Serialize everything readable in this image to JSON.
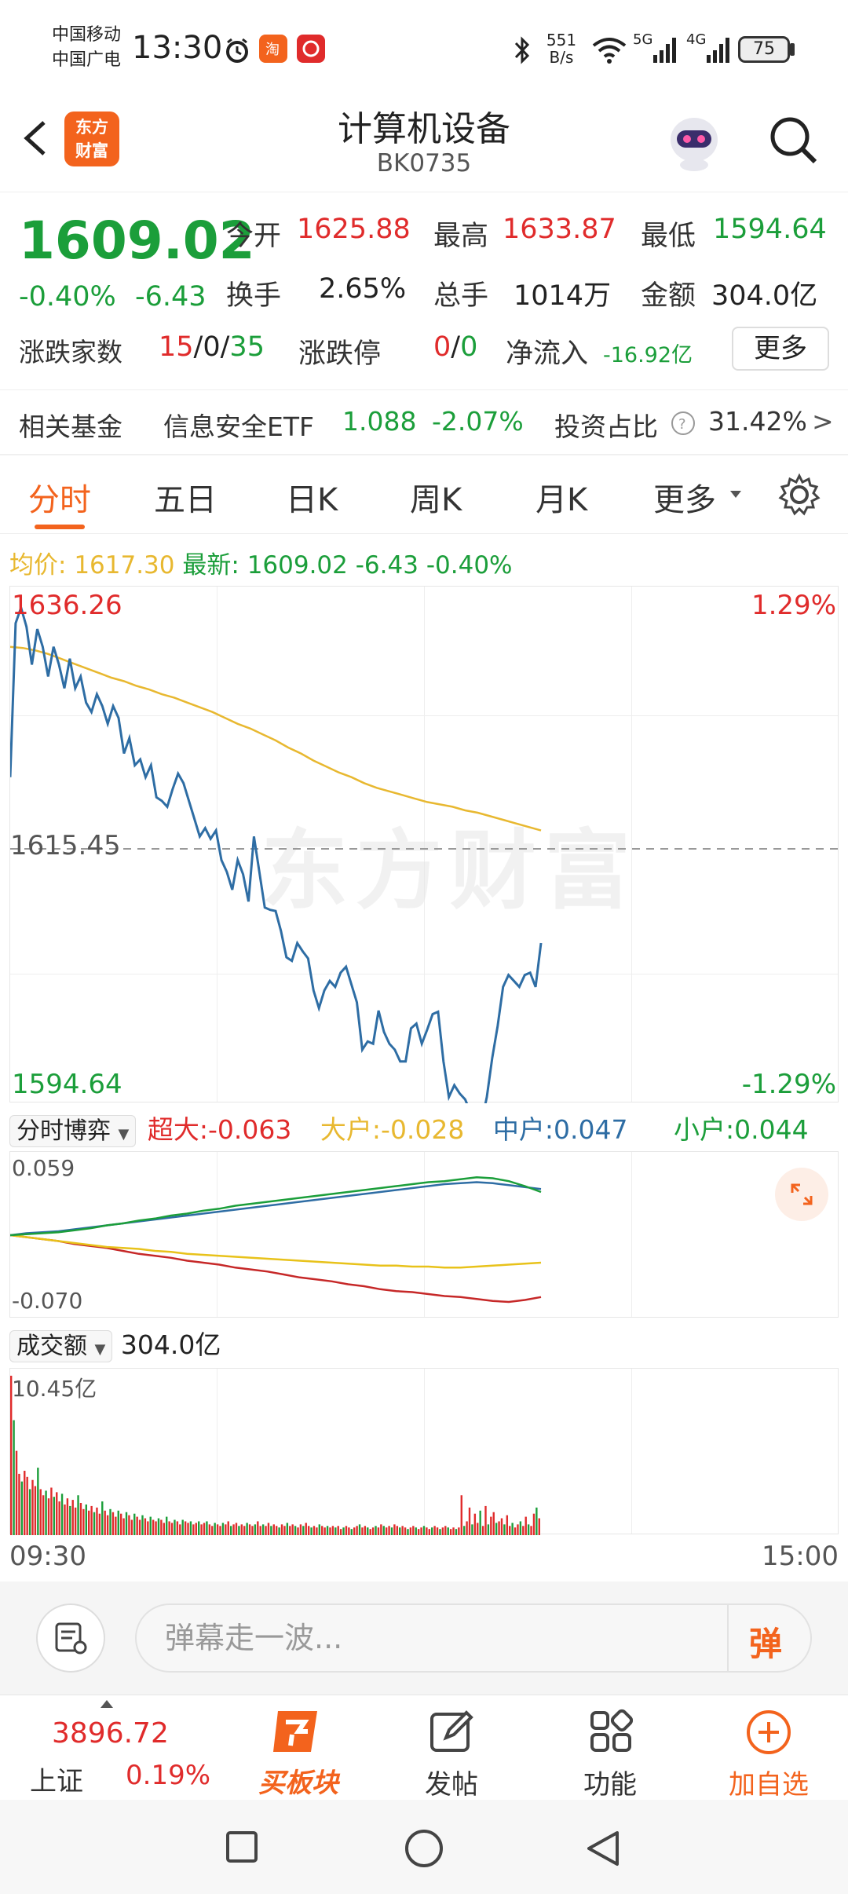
{
  "status_bar": {
    "carrier1": "中国移动",
    "carrier2": "中国广电",
    "time": "13:30",
    "net_speed_value": "551",
    "net_speed_unit": "B/s",
    "sig1": "5G",
    "sig2": "4G",
    "battery": "75",
    "icons": [
      "alarm-icon",
      "taobao-icon",
      "app-icon",
      "bluetooth-icon",
      "wifi-icon",
      "signal-icon"
    ]
  },
  "header": {
    "logo_line1": "东方",
    "logo_line2": "财富",
    "title": "计算机设备",
    "code": "BK0735"
  },
  "quote": {
    "price": "1609.02",
    "change_pct": "-0.40%",
    "change": "-6.43",
    "open_label": "今开",
    "open": "1625.88",
    "high_label": "最高",
    "high": "1633.87",
    "low_label": "最低",
    "low": "1594.64",
    "turnover_label": "换手",
    "turnover": "2.65%",
    "volume_label": "总手",
    "volume": "1014万",
    "amount_label": "金额",
    "amount": "304.0亿",
    "updown_label": "涨跌家数",
    "up": "15",
    "sep1": "/",
    "flat": "0",
    "sep2": "/",
    "down": "35",
    "limit_label": "涨跌停",
    "limit_up": "0",
    "limit_sep": "/",
    "limit_down": "0",
    "inflow_label": "净流入",
    "inflow": "-16.92亿",
    "more": "更多"
  },
  "fund": {
    "label": "相关基金",
    "name": "信息安全ETF",
    "price": "1.088",
    "change": "-2.07%",
    "ratio_label": "投资占比",
    "ratio": "31.42%",
    "arrow": ">"
  },
  "tabs": [
    {
      "label": "分时"
    },
    {
      "label": "五日"
    },
    {
      "label": "日K"
    },
    {
      "label": "周K"
    },
    {
      "label": "月K"
    },
    {
      "label": "更多"
    }
  ],
  "info_line": {
    "avg_label": "均价:",
    "avg": "1617.30",
    "last_label": "最新:",
    "last": "1609.02",
    "change": "-6.43",
    "pct": "-0.40%"
  },
  "chart_data": {
    "type": "line",
    "x_range": [
      "09:30",
      "15:00"
    ],
    "ylim": [
      1594.64,
      1636.26
    ],
    "pct_range": [
      "1.29%",
      "-1.29%"
    ],
    "prev_close": "1615.45",
    "y_top_label": "1636.26",
    "y_bottom_label": "1594.64",
    "watermark": "东方财富",
    "series": [
      {
        "name": "",
        "color": "#2e6da4",
        "values": [
          1621.5,
          1634.5,
          1635.8,
          1634.2,
          1631.0,
          1634.0,
          1632.5,
          1630.0,
          1632.5,
          1631.0,
          1629.0,
          1631.5,
          1629.0,
          1630.0,
          1627.8,
          1627.0,
          1628.5,
          1627.5,
          1626.0,
          1627.5,
          1626.5,
          1623.5,
          1624.8,
          1622.5,
          1623.0,
          1621.5,
          1622.5,
          1619.8,
          1619.5,
          1619.0,
          1620.5,
          1621.8,
          1621.0,
          1619.5,
          1618.0,
          1616.5,
          1617.2,
          1616.3,
          1617.0,
          1614.5,
          1613.5,
          1612.0,
          1614.5,
          1613.3,
          1611.0,
          1616.5,
          1613.5,
          1610.5,
          1610.3,
          1610.2,
          1608.5,
          1606.3,
          1606.0,
          1607.5,
          1606.8,
          1606.2,
          1603.5,
          1602.0,
          1603.5,
          1604.3,
          1603.8,
          1605.0,
          1605.5,
          1604.0,
          1602.5,
          1598.5,
          1599.2,
          1599.0,
          1601.8,
          1600.0,
          1599.0,
          1598.5,
          1597.5,
          1597.5,
          1600.3,
          1600.7,
          1599.0,
          1600.2,
          1601.5,
          1601.7,
          1597.5,
          1594.5,
          1595.5,
          1594.8,
          1594.3,
          1593.2,
          1592.5,
          1592.3,
          1594.5,
          1597.8,
          1600.5,
          1603.8,
          1604.8,
          1604.3,
          1603.8,
          1604.8,
          1605.0,
          1603.8,
          1607.5
        ]
      },
      {
        "name": "均价",
        "color": "#e8b830",
        "values": [
          1632.5,
          1632.4,
          1632.2,
          1631.9,
          1631.5,
          1631.1,
          1630.7,
          1630.3,
          1629.9,
          1629.6,
          1629.2,
          1628.9,
          1628.5,
          1628.2,
          1627.8,
          1627.4,
          1627.0,
          1626.5,
          1626.0,
          1625.6,
          1625.1,
          1624.6,
          1624.0,
          1623.5,
          1622.9,
          1622.4,
          1621.9,
          1621.5,
          1621.0,
          1620.6,
          1620.3,
          1620.0,
          1619.7,
          1619.4,
          1619.2,
          1619.0,
          1618.7,
          1618.5,
          1618.2,
          1617.9,
          1617.6,
          1617.3,
          1617.0
        ]
      }
    ]
  },
  "bargain": {
    "select": "分时博弈",
    "super_label": "超大:",
    "super": "-0.063",
    "big_label": "大户:",
    "big": "-0.028",
    "mid_label": "中户:",
    "mid": "0.047",
    "small_label": "小户:",
    "small": "0.044",
    "top": "0.059",
    "bottom": "-0.070",
    "series": [
      {
        "name": "超大",
        "color": "#c62828",
        "values": [
          0,
          -0.002,
          -0.004,
          -0.006,
          -0.009,
          -0.011,
          -0.013,
          -0.016,
          -0.019,
          -0.021,
          -0.023,
          -0.026,
          -0.028,
          -0.03,
          -0.033,
          -0.035,
          -0.037,
          -0.04,
          -0.043,
          -0.045,
          -0.047,
          -0.05,
          -0.052,
          -0.055,
          -0.057,
          -0.058,
          -0.06,
          -0.062,
          -0.063,
          -0.065,
          -0.067,
          -0.068,
          -0.066,
          -0.063
        ]
      },
      {
        "name": "大户",
        "color": "#e8c21a",
        "values": [
          0,
          -0.002,
          -0.004,
          -0.006,
          -0.008,
          -0.01,
          -0.012,
          -0.013,
          -0.014,
          -0.016,
          -0.017,
          -0.019,
          -0.02,
          -0.021,
          -0.022,
          -0.023,
          -0.024,
          -0.025,
          -0.026,
          -0.027,
          -0.028,
          -0.029,
          -0.03,
          -0.031,
          -0.031,
          -0.032,
          -0.032,
          -0.033,
          -0.033,
          -0.032,
          -0.031,
          -0.03,
          -0.029,
          -0.028
        ]
      },
      {
        "name": "中户",
        "color": "#2e6da4",
        "values": [
          0,
          0.002,
          0.003,
          0.004,
          0.006,
          0.008,
          0.01,
          0.012,
          0.014,
          0.016,
          0.018,
          0.02,
          0.022,
          0.024,
          0.026,
          0.028,
          0.03,
          0.032,
          0.034,
          0.036,
          0.038,
          0.04,
          0.042,
          0.044,
          0.046,
          0.048,
          0.05,
          0.052,
          0.053,
          0.054,
          0.053,
          0.051,
          0.049,
          0.047
        ]
      },
      {
        "name": "小户",
        "color": "#1b9e3a",
        "values": [
          0,
          0.001,
          0.002,
          0.003,
          0.005,
          0.007,
          0.01,
          0.012,
          0.015,
          0.017,
          0.02,
          0.022,
          0.025,
          0.027,
          0.03,
          0.032,
          0.034,
          0.036,
          0.038,
          0.04,
          0.042,
          0.044,
          0.046,
          0.048,
          0.05,
          0.052,
          0.054,
          0.055,
          0.057,
          0.059,
          0.058,
          0.055,
          0.05,
          0.044
        ]
      }
    ]
  },
  "volume_panel": {
    "select": "成交额",
    "total": "304.0亿",
    "max_label": "10.45亿",
    "time_start": "09:30",
    "time_end": "15:00",
    "bars": [
      10.4,
      7.5,
      5.5,
      4.0,
      3.5,
      4.2,
      3.8,
      3.0,
      3.6,
      3.2,
      4.4,
      3.0,
      2.6,
      2.9,
      2.4,
      3.1,
      2.5,
      2.8,
      2.2,
      2.7,
      2.0,
      2.4,
      1.9,
      2.3,
      1.8,
      2.6,
      2.1,
      1.7,
      2.0,
      1.6,
      1.9,
      1.5,
      1.8,
      1.4,
      2.2,
      1.6,
      1.3,
      1.7,
      1.5,
      1.2,
      1.6,
      1.4,
      1.1,
      1.5,
      1.3,
      1.0,
      1.4,
      1.2,
      1.0,
      1.3,
      1.1,
      0.9,
      1.2,
      1.0,
      0.9,
      1.1,
      1.0,
      0.8,
      1.2,
      0.9,
      0.8,
      1.0,
      0.9,
      0.7,
      1.0,
      0.9,
      0.8,
      0.9,
      0.7,
      0.8,
      0.9,
      0.7,
      0.8,
      0.9,
      0.7,
      0.6,
      0.8,
      0.7,
      0.6,
      0.8,
      0.7,
      0.9,
      0.6,
      0.7,
      0.8,
      0.6,
      0.7,
      0.6,
      0.8,
      0.7,
      0.6,
      0.7,
      0.9,
      0.6,
      0.7,
      0.6,
      0.8,
      0.6,
      0.7,
      0.6,
      0.5,
      0.7,
      0.6,
      0.8,
      0.6,
      0.7,
      0.6,
      0.5,
      0.7,
      0.6,
      0.8,
      0.6,
      0.5,
      0.6,
      0.5,
      0.7,
      0.6,
      0.5,
      0.6,
      0.5,
      0.6,
      0.5,
      0.6,
      0.4,
      0.5,
      0.6,
      0.5,
      0.4,
      0.5,
      0.6,
      0.7,
      0.5,
      0.6,
      0.5,
      0.4,
      0.5,
      0.6,
      0.5,
      0.7,
      0.6,
      0.5,
      0.6,
      0.5,
      0.7,
      0.6,
      0.5,
      0.6,
      0.5,
      0.4,
      0.5,
      0.6,
      0.5,
      0.4,
      0.5,
      0.6,
      0.5,
      0.4,
      0.5,
      0.6,
      0.5,
      0.4,
      0.5,
      0.6,
      0.5,
      0.4,
      0.5,
      0.4,
      0.5,
      2.6,
      0.6,
      0.9,
      1.8,
      0.7,
      1.4,
      0.8,
      1.6,
      0.6,
      1.9,
      0.7,
      1.2,
      1.5,
      0.8,
      0.9,
      1.1,
      0.7,
      1.3,
      0.6,
      0.8,
      0.5,
      0.7,
      0.9,
      0.6,
      1.2,
      0.7,
      0.6,
      1.4,
      1.8,
      1.1
    ],
    "up_color": "#e02b2b",
    "down_color": "#1b9e3a"
  },
  "comment_bar": {
    "placeholder": "弹幕走一波...",
    "danmaku": "弹"
  },
  "bottom_bar": {
    "index_value": "3896.72",
    "index_name": "上证",
    "index_pct": "0.19%",
    "buy_label": "买板块",
    "post_label": "发帖",
    "func_label": "功能",
    "add_label": "加自选"
  }
}
